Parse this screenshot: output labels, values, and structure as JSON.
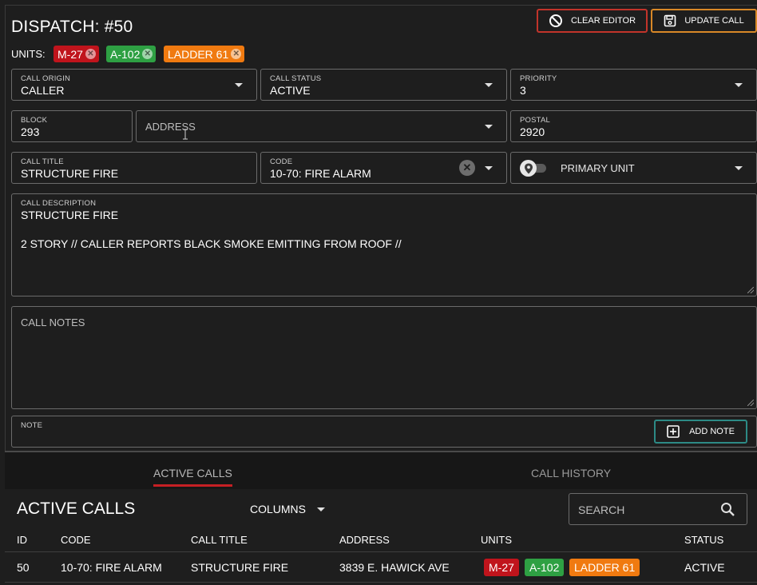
{
  "header": {
    "title": "DISPATCH: #50",
    "clear_button": "CLEAR EDITOR",
    "update_button": "UPDATE CALL"
  },
  "units": {
    "label": "UNITS:",
    "chips": [
      {
        "label": "M-27",
        "color": "#c0141c"
      },
      {
        "label": "A-102",
        "color": "#2ea043"
      },
      {
        "label": "LADDER 61",
        "color": "#f07a10"
      }
    ]
  },
  "form": {
    "call_origin": {
      "label": "CALL ORIGIN",
      "value": "CALLER"
    },
    "call_status": {
      "label": "CALL STATUS",
      "value": "ACTIVE"
    },
    "priority": {
      "label": "PRIORITY",
      "value": "3"
    },
    "block": {
      "label": "BLOCK",
      "value": "293"
    },
    "address": {
      "placeholder": "ADDRESS"
    },
    "postal": {
      "label": "POSTAL",
      "value": "2920"
    },
    "call_title": {
      "label": "CALL TITLE",
      "value": "STRUCTURE FIRE"
    },
    "code": {
      "label": "CODE",
      "value": "10-70: FIRE ALARM"
    },
    "primary_unit": {
      "label": "PRIMARY UNIT"
    },
    "description": {
      "label": "CALL DESCRIPTION",
      "line1": "STRUCTURE FIRE",
      "line2": "2 STORY // CALLER REPORTS BLACK SMOKE EMITTING FROM ROOF //"
    },
    "notes": {
      "placeholder": "CALL NOTES"
    },
    "note": {
      "label": "NOTE"
    },
    "add_note_button": "ADD NOTE"
  },
  "tabs": {
    "active": "ACTIVE CALLS",
    "history": "CALL HISTORY"
  },
  "active_calls": {
    "title": "ACTIVE CALLS",
    "columns_button": "COLUMNS",
    "search_placeholder": "SEARCH",
    "headers": [
      "ID",
      "CODE",
      "CALL TITLE",
      "ADDRESS",
      "UNITS",
      "STATUS"
    ],
    "rows": [
      {
        "id": "50",
        "code": "10-70: FIRE ALARM",
        "title": "STRUCTURE FIRE",
        "address": "3839 E. HAWICK AVE",
        "units": [
          "M-27",
          "A-102",
          "LADDER 61"
        ],
        "status": "ACTIVE"
      }
    ]
  },
  "colors": {
    "background": "#1e1e1e",
    "clear_border": "#c2342b",
    "update_border": "#d88827",
    "add_note_border": "#2d8a86",
    "tab_underline": "#c51f24"
  }
}
